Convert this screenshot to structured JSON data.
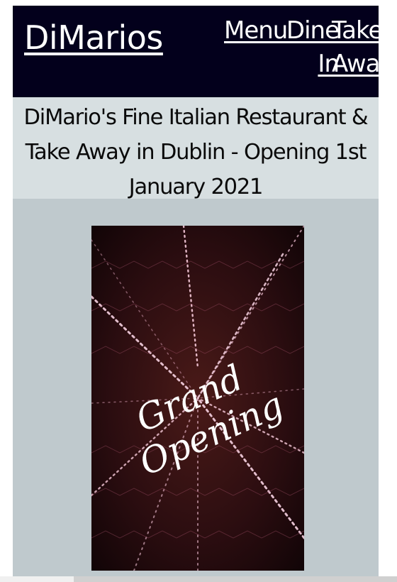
{
  "brand": "DiMarios",
  "nav": {
    "menu": "Menu",
    "dine_in": "Dine\nIn",
    "take_away": "Take\nAway"
  },
  "banner_title": "DiMario's Fine Italian Restaurant & Take Away in Dublin - Opening 1st January 2021",
  "hero_text_line1": "Grand",
  "hero_text_line2": "Opening",
  "colors": {
    "navbar": "#03001c",
    "banner": "#d7dfe1",
    "page": "#bfc9cd",
    "hero_bg": "#2a0d10"
  }
}
